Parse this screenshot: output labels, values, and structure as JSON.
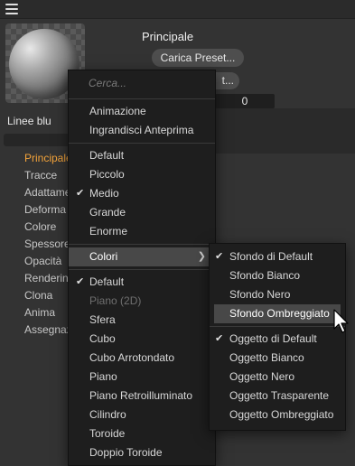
{
  "topbar": {
    "menu_icon": "hamburger-icon"
  },
  "material": {
    "name": "Linee blu"
  },
  "sidebar": {
    "items": [
      {
        "label": "Principale",
        "active": true
      },
      {
        "label": "Tracce"
      },
      {
        "label": "Adattamento"
      },
      {
        "label": "Deforma"
      },
      {
        "label": "Colore"
      },
      {
        "label": "Spessore"
      },
      {
        "label": "Opacità"
      },
      {
        "label": "Rendering"
      },
      {
        "label": "Clona"
      },
      {
        "label": "Anima"
      },
      {
        "label": "Assegnazione"
      }
    ]
  },
  "panel": {
    "title": "Principale",
    "preset_button": "Carica Preset...",
    "second_button": "t...",
    "number_value": "0"
  },
  "context_menu": {
    "search_placeholder": "Cerca...",
    "group1": [
      "Animazione",
      "Ingrandisci Anteprima"
    ],
    "sizes": [
      {
        "label": "Default"
      },
      {
        "label": "Piccolo"
      },
      {
        "label": "Medio",
        "checked": true
      },
      {
        "label": "Grande"
      },
      {
        "label": "Enorme"
      }
    ],
    "colori": {
      "label": "Colori",
      "arrow": "chevron-right-icon"
    },
    "shapes": [
      {
        "label": "Default",
        "checked": true
      },
      {
        "label": "Piano (2D)",
        "disabled": true
      },
      {
        "label": "Sfera"
      },
      {
        "label": "Cubo"
      },
      {
        "label": "Cubo Arrotondato"
      },
      {
        "label": "Piano"
      },
      {
        "label": "Piano Retroilluminato"
      },
      {
        "label": "Cilindro"
      },
      {
        "label": "Toroide"
      },
      {
        "label": "Doppio Toroide"
      }
    ]
  },
  "colori_submenu": {
    "backgrounds": [
      {
        "label": "Sfondo di Default",
        "checked": true
      },
      {
        "label": "Sfondo Bianco"
      },
      {
        "label": "Sfondo Nero"
      },
      {
        "label": "Sfondo Ombreggiato",
        "highlighted": true
      }
    ],
    "objects": [
      {
        "label": "Oggetto di Default",
        "checked": true
      },
      {
        "label": "Oggetto Bianco"
      },
      {
        "label": "Oggetto Nero"
      },
      {
        "label": "Oggetto Trasparente"
      },
      {
        "label": "Oggetto Ombreggiato"
      }
    ]
  },
  "colors": {
    "accent": "#f3a33a",
    "menu_bg": "#1e1e1e",
    "highlight": "#484848"
  }
}
